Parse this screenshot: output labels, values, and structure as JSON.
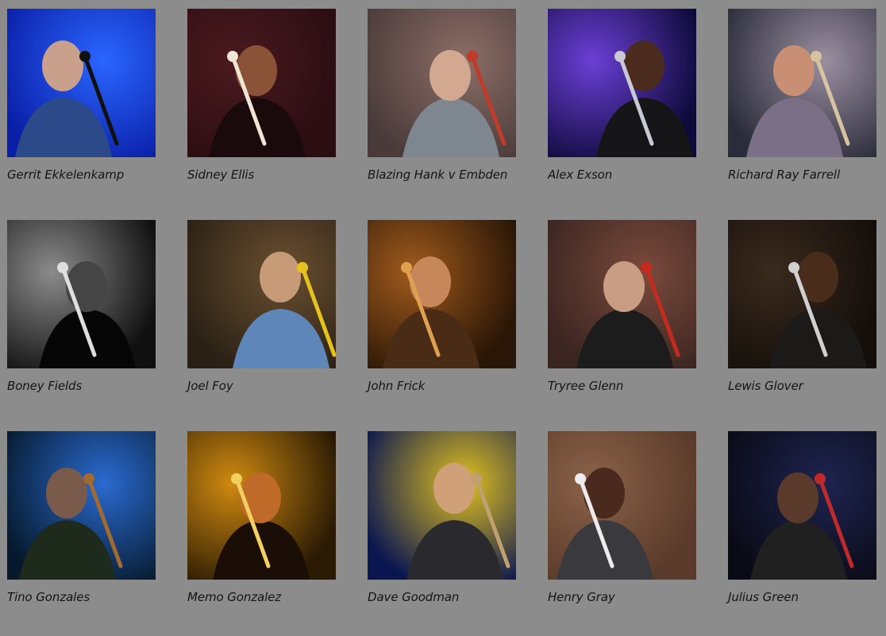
{
  "artists": [
    {
      "name": "Gerrit Ekkelenkamp",
      "photo": {
        "bg": "#0a1fa8",
        "glow": "#2a66ff",
        "skin": "#c9a08c",
        "cloth": "#2c4a8a",
        "accent": "#111111",
        "mono": false
      }
    },
    {
      "name": "Sidney Ellis",
      "photo": {
        "bg": "#2b0d12",
        "glow": "#4a1a1e",
        "skin": "#8a5236",
        "cloth": "#1a0a0c",
        "accent": "#f0e6d6",
        "mono": false
      }
    },
    {
      "name": "Blazing Hank v Embden",
      "photo": {
        "bg": "#4a3b3a",
        "glow": "#8b6e66",
        "skin": "#d2a891",
        "cloth": "#7e8690",
        "accent": "#c23a2a",
        "mono": false
      }
    },
    {
      "name": "Alex Exson",
      "photo": {
        "bg": "#0e0a3a",
        "glow": "#6b3fd6",
        "skin": "#4a2b1e",
        "cloth": "#151518",
        "accent": "#c9c9d6",
        "mono": false
      }
    },
    {
      "name": "Richard Ray Farrell",
      "photo": {
        "bg": "#2b2c3a",
        "glow": "#9a8fa0",
        "skin": "#c98f74",
        "cloth": "#7a6f86",
        "accent": "#d7c3a0",
        "mono": false
      }
    },
    {
      "name": "Boney Fields",
      "photo": {
        "bg": "#1a1a1a",
        "glow": "#8a8a8a",
        "skin": "#4a4a4a",
        "cloth": "#111111",
        "accent": "#d6d6d6",
        "mono": true
      }
    },
    {
      "name": "Joel Foy",
      "photo": {
        "bg": "#2a2015",
        "glow": "#6a5030",
        "skin": "#c79a78",
        "cloth": "#5e86b8",
        "accent": "#e6c21c",
        "mono": false
      }
    },
    {
      "name": "John Frick",
      "photo": {
        "bg": "#2a1606",
        "glow": "#a05a1c",
        "skin": "#c6875a",
        "cloth": "#4a2c16",
        "accent": "#e0a050",
        "mono": false
      }
    },
    {
      "name": "Tryree Glenn",
      "photo": {
        "bg": "#3a2520",
        "glow": "#7a4a3c",
        "skin": "#c99c84",
        "cloth": "#1c1c1c",
        "accent": "#c62a1e",
        "mono": false
      }
    },
    {
      "name": "Lewis Glover",
      "photo": {
        "bg": "#140e0a",
        "glow": "#3a2a1e",
        "skin": "#4a2c1a",
        "cloth": "#1c1a18",
        "accent": "#d0d0d0",
        "mono": false
      }
    },
    {
      "name": "Tino Gonzales",
      "photo": {
        "bg": "#061a2e",
        "glow": "#2a6ad0",
        "skin": "#7a5a4a",
        "cloth": "#1e2a1c",
        "accent": "#a06a30",
        "mono": false
      }
    },
    {
      "name": "Memo Gonzalez",
      "photo": {
        "bg": "#2a1a04",
        "glow": "#d08a10",
        "skin": "#c06a2a",
        "cloth": "#1a0e06",
        "accent": "#f2d060",
        "mono": false
      }
    },
    {
      "name": "Dave Goodman",
      "photo": {
        "bg": "#0a1650",
        "glow": "#e0c020",
        "skin": "#d0a078",
        "cloth": "#2a2a2e",
        "accent": "#c0a070",
        "mono": false
      }
    },
    {
      "name": "Henry Gray",
      "photo": {
        "bg": "#5a3a2a",
        "glow": "#8a6248",
        "skin": "#4a2a1e",
        "cloth": "#3a3a3e",
        "accent": "#ececec",
        "mono": false
      }
    },
    {
      "name": "Julius Green",
      "photo": {
        "bg": "#0a0a16",
        "glow": "#1e2450",
        "skin": "#5a3a2a",
        "cloth": "#202020",
        "accent": "#c02a2a",
        "mono": false
      }
    }
  ]
}
